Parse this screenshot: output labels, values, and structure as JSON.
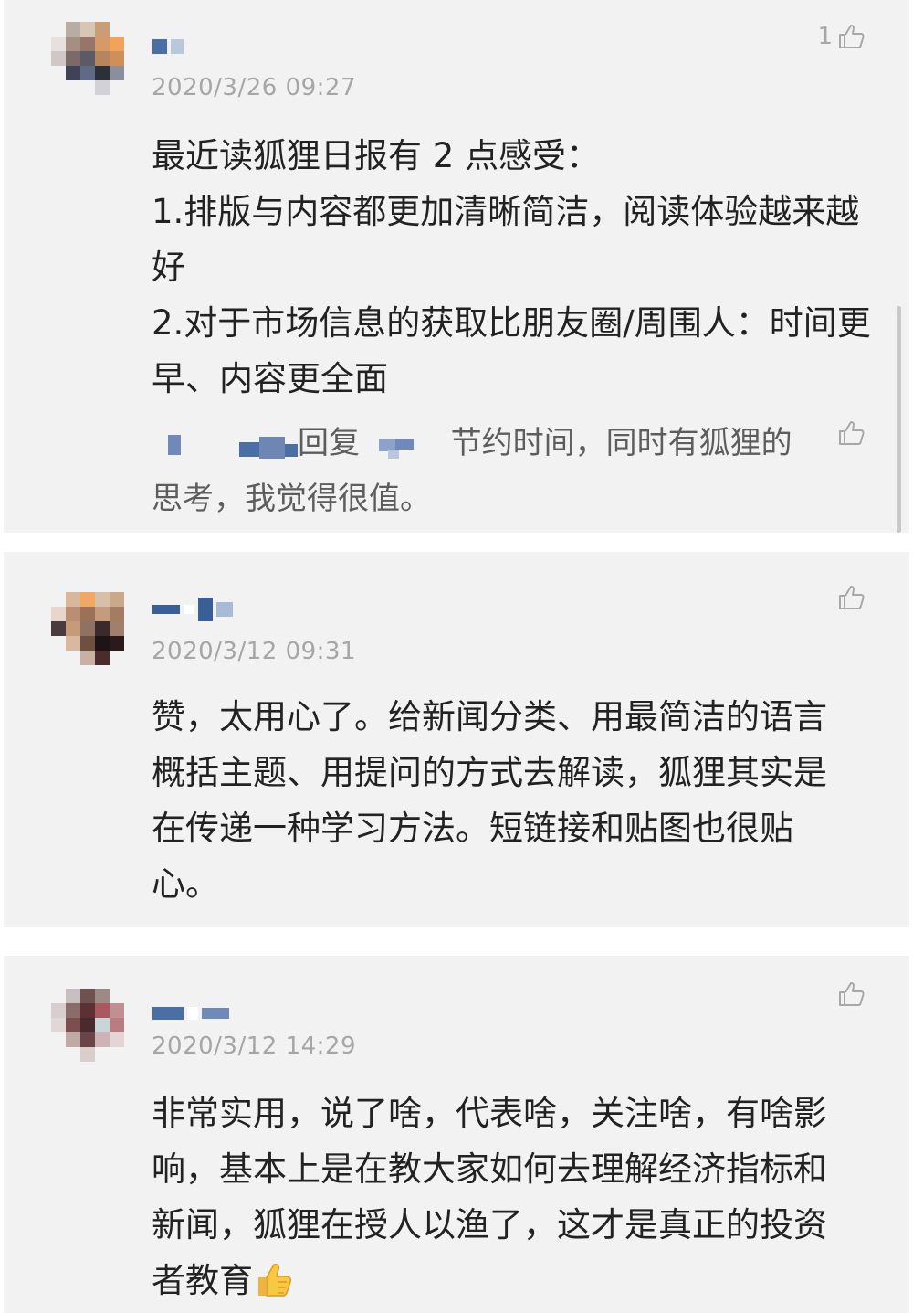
{
  "comments": [
    {
      "timestamp": "2020/3/26 09:27",
      "like_count": "1",
      "text": "最近读狐狸日报有 2 点感受：\n1.排版与内容都更加清晰简洁，阅读体验越来越好\n2.对于市场信息的获取比朋友圈/周围人：时间更早、内容更全面",
      "reply": {
        "verb": "回复",
        "text": "节约时间，同时有狐狸的思考，我觉得很值。"
      }
    },
    {
      "timestamp": "2020/3/12 09:31",
      "like_count": "",
      "text": "赞，太用心了。给新闻分类、用最简洁的语言概括主题、用提问的方式去解读，狐狸其实是在传递一种学习方法。短链接和贴图也很贴心。"
    },
    {
      "timestamp": "2020/3/12 14:29",
      "like_count": "",
      "text": "非常实用，说了啥，代表啥，关注啥，有啥影响，基本上是在教大家如何去理解经济指标和新闻，狐狸在授人以渔了，这才是真正的投资者教育",
      "emoji": "thumbs-up-emoji"
    }
  ],
  "icons": {
    "like": "thumbs-up-outline-icon"
  },
  "colors": {
    "card_background": "#f2f2f2",
    "timestamp": "#a6a6a6",
    "body_text": "#222222",
    "reply_text": "#5d5d5d",
    "like_icon": "#a8a8a8"
  }
}
